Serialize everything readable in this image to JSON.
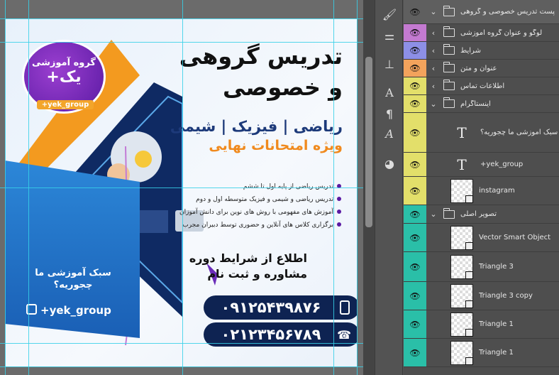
{
  "poster": {
    "badge_line1": "گروه آموزشی",
    "badge_line2": "+یک",
    "badge_tag": "+yek_group",
    "title_line1": "تدریس گروهی",
    "title_line2": "و خصوصی",
    "subjects": "ریاضی | فیزیک | شیمی",
    "subtitle": "ویژه امتحانات نهایی",
    "bullets": [
      "تدریس ریاضی از پایه اول تا ششم",
      "تدریس ریاضی و شیمی و فیزیک متوسطه اول و دوم",
      "آموزش های مفهومی با روش های نوین برای دانش آموزان",
      "برگزاری کلاس های آنلاین و حضوری توسط دبیران مجرب"
    ],
    "cta_line1": "اطلاع از شرایط دوره",
    "cta_line2": "مشاوره و ثبت نام",
    "phone1": "۰۹۱۲۵۴۳۹۸۷۶",
    "phone2": "۰۲۱۲۳۴۵۶۷۸۹",
    "side_text": "سبک آموزشی ما چجوریه؟",
    "instagram": "+yek_group",
    "colors": {
      "primary": "#0e2352",
      "accent": "#f3a52a",
      "purple": "#5a1aa3",
      "blue": "#2c87d8"
    }
  },
  "layers": [
    {
      "name": "پست تدریس خصوصی و گروهی",
      "kind": "group-open",
      "color": "#5f5f5f"
    },
    {
      "name": "لوگو و عنوان گروه آموزشی",
      "kind": "group",
      "color": "#c47ad1"
    },
    {
      "name": "شرایط",
      "kind": "group",
      "color": "#8d8fe6"
    },
    {
      "name": "عنوان و متن",
      "kind": "group",
      "color": "#f3a35c"
    },
    {
      "name": "اطلاعات تماس",
      "kind": "group",
      "color": "#e3df6a"
    },
    {
      "name": "اینستاگرام",
      "kind": "group-open",
      "color": "#e3df6a"
    },
    {
      "name": "سبک آموزشی ما چجوریه؟",
      "kind": "text",
      "color": "#e3df6a"
    },
    {
      "name": "+yek_group",
      "kind": "text",
      "color": "#e3df6a"
    },
    {
      "name": "instagram",
      "kind": "smart",
      "color": "#e3df6a"
    },
    {
      "name": "تصویر اصلی",
      "kind": "group-open",
      "color": "#2abfa8"
    },
    {
      "name": "Vector Smart Object",
      "kind": "smart",
      "color": "#2abfa8"
    },
    {
      "name": "Triangle 3",
      "kind": "smart",
      "color": "#2abfa8"
    },
    {
      "name": "Triangle 3 copy",
      "kind": "smart",
      "color": "#2abfa8"
    },
    {
      "name": "Triangle 1",
      "kind": "smart",
      "color": "#2abfa8"
    },
    {
      "name": "Triangle 1",
      "kind": "smart",
      "color": "#2abfa8"
    }
  ],
  "tools": [
    "brush-icon",
    "adjust-icon",
    "clone-stamp-icon",
    "paragraph-A-icon",
    "pilcrow-icon",
    "glyphs-A-icon",
    "3d-sphere-icon"
  ]
}
